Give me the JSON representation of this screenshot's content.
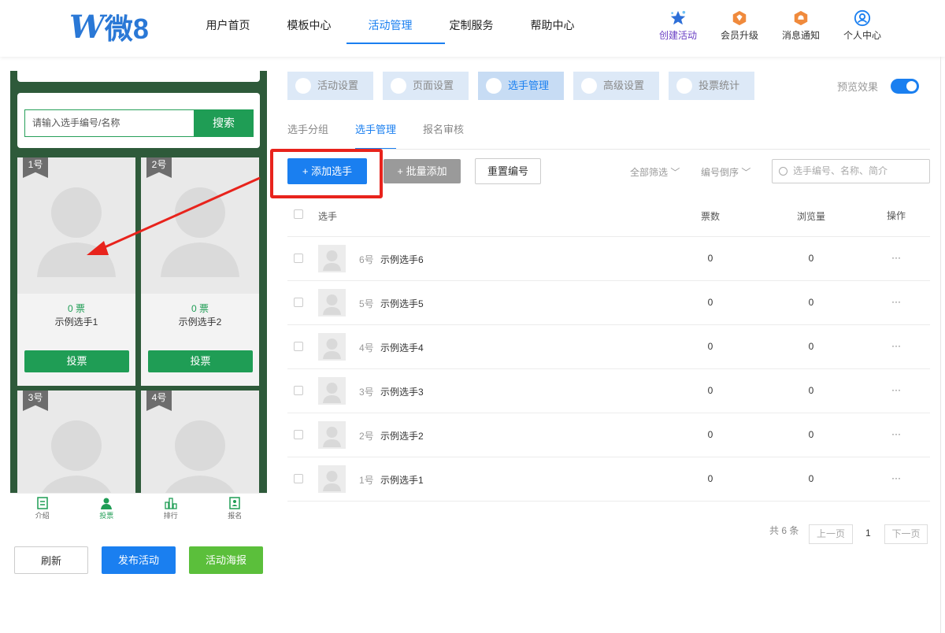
{
  "header": {
    "logo": {
      "mark": "W",
      "text": "微8"
    },
    "nav": [
      {
        "label": "用户首页",
        "active": false
      },
      {
        "label": "模板中心",
        "active": false
      },
      {
        "label": "活动管理",
        "active": true
      },
      {
        "label": "定制服务",
        "active": false
      },
      {
        "label": "帮助中心",
        "active": false
      }
    ],
    "actions": [
      {
        "label": "创建活动",
        "icon": "star-icon"
      },
      {
        "label": "会员升级",
        "icon": "diamond-badge-icon"
      },
      {
        "label": "消息通知",
        "icon": "bell-badge-icon"
      },
      {
        "label": "个人中心",
        "icon": "user-circle-icon"
      }
    ]
  },
  "phone_preview": {
    "search": {
      "placeholder": "请输入选手编号/名称",
      "button": "搜索"
    },
    "players": [
      {
        "tag": "1号",
        "votes": "0 票",
        "name": "示例选手1",
        "vote_button": "投票"
      },
      {
        "tag": "2号",
        "votes": "0 票",
        "name": "示例选手2",
        "vote_button": "投票"
      },
      {
        "tag": "3号"
      },
      {
        "tag": "4号"
      }
    ],
    "bottom_nav": [
      {
        "label": "介绍",
        "icon": "document-icon",
        "active": false
      },
      {
        "label": "投票",
        "icon": "person-icon",
        "active": true
      },
      {
        "label": "排行",
        "icon": "bar-chart-icon",
        "active": false
      },
      {
        "label": "报名",
        "icon": "signup-icon",
        "active": false
      }
    ],
    "buttons": {
      "refresh": "刷新",
      "publish": "发布活动",
      "poster": "活动海报"
    },
    "colors": {
      "theme_green": "#1f9d55",
      "background": "#2e5a3a"
    }
  },
  "settings_tabs": [
    {
      "label": "活动设置",
      "icon": "heart-icon",
      "active": false
    },
    {
      "label": "页面设置",
      "icon": "page-icon",
      "active": false
    },
    {
      "label": "选手管理",
      "icon": "person-icon",
      "active": true
    },
    {
      "label": "高级设置",
      "icon": "tools-icon",
      "active": false
    },
    {
      "label": "投票统计",
      "icon": "stats-icon",
      "active": false
    }
  ],
  "preview": {
    "label": "预览效果",
    "enabled": true
  },
  "sub_tabs": [
    {
      "label": "选手分组",
      "active": false
    },
    {
      "label": "选手管理",
      "active": true
    },
    {
      "label": "报名审核",
      "active": false
    }
  ],
  "toolbar": {
    "add": "+ 添加选手",
    "batch_add": "+ 批量添加",
    "renumber": "重置编号",
    "filter_all": "全部筛选",
    "sort_order": "编号倒序",
    "search_placeholder": "选手编号、名称、简介"
  },
  "table": {
    "headers": {
      "player": "选手",
      "votes": "票数",
      "views": "浏览量",
      "ops": "操作"
    },
    "rows": [
      {
        "num": "6号",
        "name": "示例选手6",
        "votes": "0",
        "views": "0",
        "ops": "···"
      },
      {
        "num": "5号",
        "name": "示例选手5",
        "votes": "0",
        "views": "0",
        "ops": "···"
      },
      {
        "num": "4号",
        "name": "示例选手4",
        "votes": "0",
        "views": "0",
        "ops": "···"
      },
      {
        "num": "3号",
        "name": "示例选手3",
        "votes": "0",
        "views": "0",
        "ops": "···"
      },
      {
        "num": "2号",
        "name": "示例选手2",
        "votes": "0",
        "views": "0",
        "ops": "···"
      },
      {
        "num": "1号",
        "name": "示例选手1",
        "votes": "0",
        "views": "0",
        "ops": "···"
      }
    ]
  },
  "pagination": {
    "total": "共 6 条",
    "prev": "上一页",
    "current": "1",
    "next": "下一页"
  },
  "colors": {
    "accent": "#1a7ff0",
    "annotation_red": "#e8231c"
  }
}
